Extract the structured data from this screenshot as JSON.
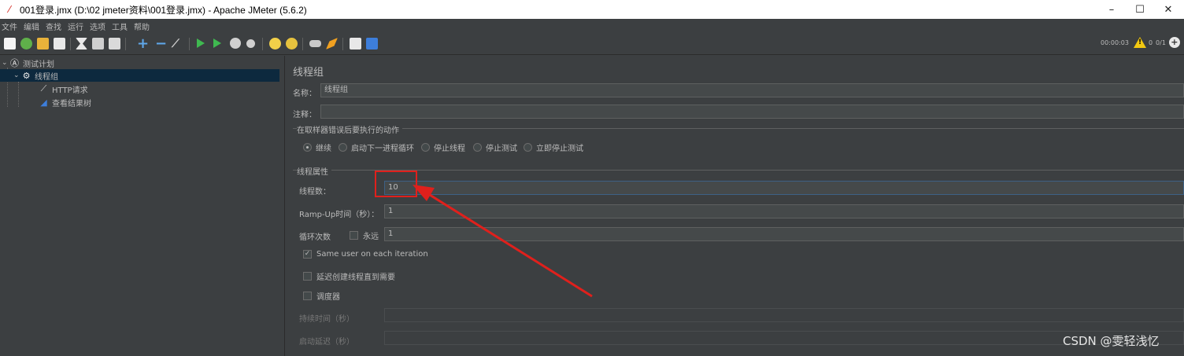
{
  "window": {
    "title": "001登录.jmx (D:\\02 jmeter资料\\001登录.jmx) - Apache JMeter (5.6.2)",
    "minimize": "–",
    "maximize": "☐",
    "close": "✕"
  },
  "menu": [
    "文件",
    "编辑",
    "查找",
    "运行",
    "选项",
    "工具",
    "帮助"
  ],
  "status": {
    "elapsed": "00:00:03",
    "warnings": "0",
    "threads": "0/1"
  },
  "tree": {
    "root": "测试计划",
    "thread_group": "线程组",
    "http_request": "HTTP请求",
    "result_tree": "查看结果树"
  },
  "panel": {
    "title": "线程组",
    "name_label": "名称：",
    "name_value": "线程组",
    "comment_label": "注释：",
    "comment_value": "",
    "error_group_title": "在取样器错误后要执行的动作",
    "error_options": [
      "继续",
      "启动下一进程循环",
      "停止线程",
      "停止测试",
      "立即停止测试"
    ],
    "error_selected": "继续",
    "props_title": "线程属性",
    "threads_label": "线程数：",
    "threads_value": "10",
    "rampup_label": "Ramp-Up时间（秒）：",
    "rampup_value": "1",
    "loop_label": "循环次数",
    "forever_label": "永远",
    "loop_value": "1",
    "same_user_label": "Same user on each iteration",
    "same_user_checked": true,
    "delay_label": "延迟创建线程直到需要",
    "delay_checked": false,
    "scheduler_label": "调度器",
    "scheduler_checked": false,
    "duration_label": "持续时间（秒）",
    "duration_value": "",
    "startup_delay_label": "启动延迟（秒）",
    "startup_delay_value": ""
  },
  "watermark": "CSDN @雯轻浅忆",
  "colors": {
    "background": "#3c3f41",
    "selection": "#0d293e",
    "annotation": "#e0201c",
    "warning": "#f2c811"
  }
}
